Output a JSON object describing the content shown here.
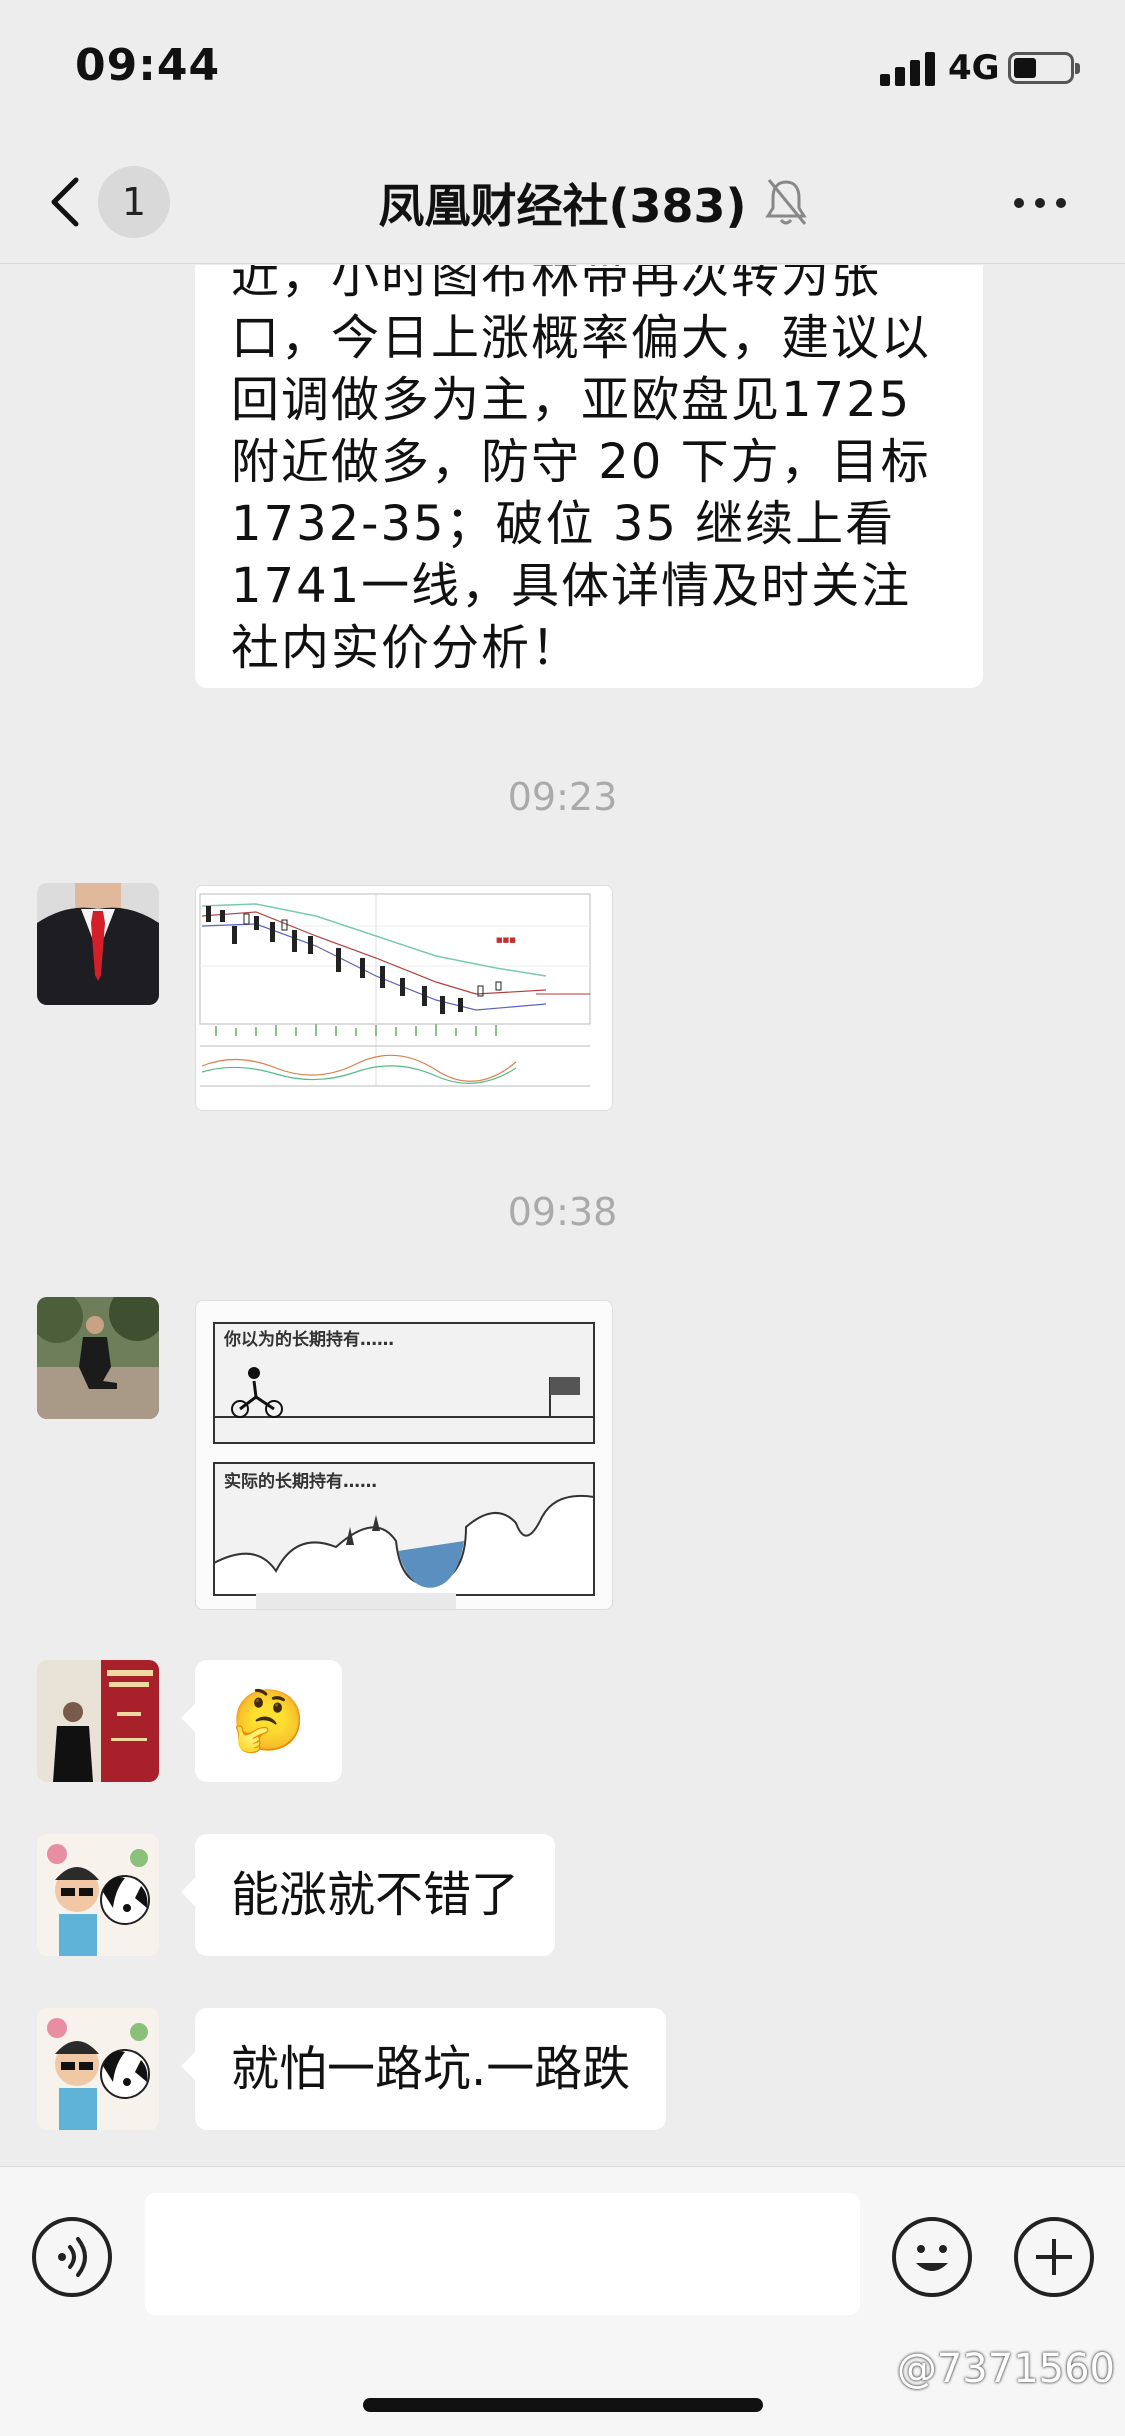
{
  "status_bar": {
    "time": "09:44",
    "network": "4G"
  },
  "nav": {
    "unread_count": "1",
    "title": "凤凰财经社(383)"
  },
  "messages": {
    "top_text": "近，小时图布林带再次转为张口，今日上涨概率偏大，建议以回调做多为主，亚欧盘见1725附近做多，防守 20 下方，目标 1732-35；破位 35 继续上看 1741一线，具体详情及时关注社内实价分析！",
    "timestamp_1": "09:23",
    "timestamp_2": "09:38",
    "cartoon_label_top": "你以为的长期持有……",
    "cartoon_label_bottom": "实际的长期持有……",
    "emoji_msg": "🤔",
    "text_msg_1": "能涨就不错了",
    "text_msg_2": "就怕一路坑.一路跌"
  },
  "input": {
    "placeholder": ""
  },
  "watermark": "@7371560"
}
